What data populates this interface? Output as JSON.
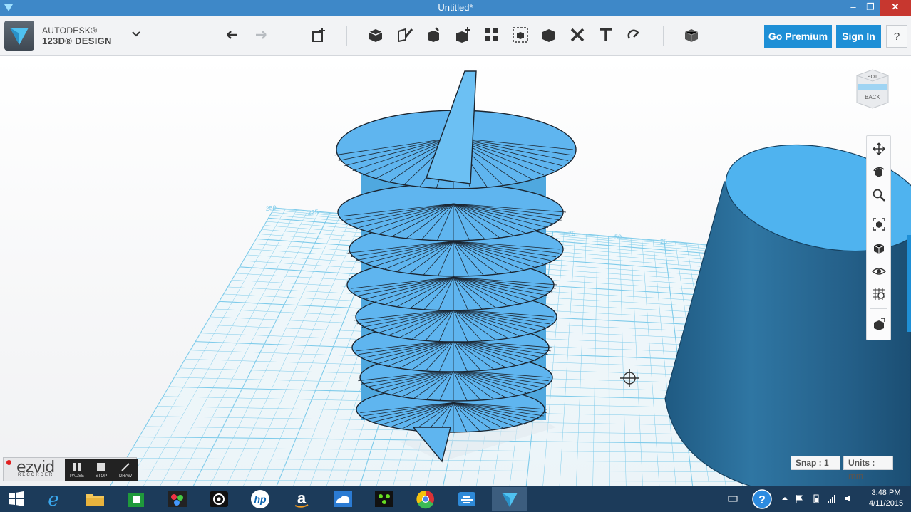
{
  "window": {
    "title": "Untitled*",
    "minimize": "–",
    "maximize": "❐",
    "close": "✕"
  },
  "brand": {
    "line1": "AUTODESK®",
    "line2": "123D® DESIGN"
  },
  "toolbar": {
    "icons": [
      "undo-icon",
      "redo-icon",
      "primitives-icon",
      "sketch-icon",
      "construct-icon",
      "modify-icon",
      "pattern-icon",
      "grouping-icon",
      "combine-icon",
      "measure-icon",
      "delete-icon",
      "text-icon",
      "snap-icon",
      "material-icon"
    ],
    "go_premium": "Go Premium",
    "sign_in": "Sign In",
    "help": "?"
  },
  "viewcube": {
    "top_label": "TOP",
    "back_label": "BACK"
  },
  "grid_labels": [
    "250",
    "225",
    "75",
    "50",
    "25"
  ],
  "status": {
    "snap": "Snap : 1",
    "units": "Units : mm"
  },
  "ezvid": {
    "logo": "ezvid",
    "subtitle": "RECORDER",
    "pause": "PAUSE",
    "stop": "STOP",
    "draw": "DRAW"
  },
  "taskbar": {
    "time": "3:48 PM",
    "date": "4/11/2015",
    "help": "?"
  },
  "colors": {
    "accent": "#1e8fd6",
    "titlebar": "#3e88c8",
    "spiral": "#5fb5ef",
    "cylinder": "#2e6e98",
    "grid": "#7ecbea",
    "taskbar": "#1c3b5a"
  }
}
